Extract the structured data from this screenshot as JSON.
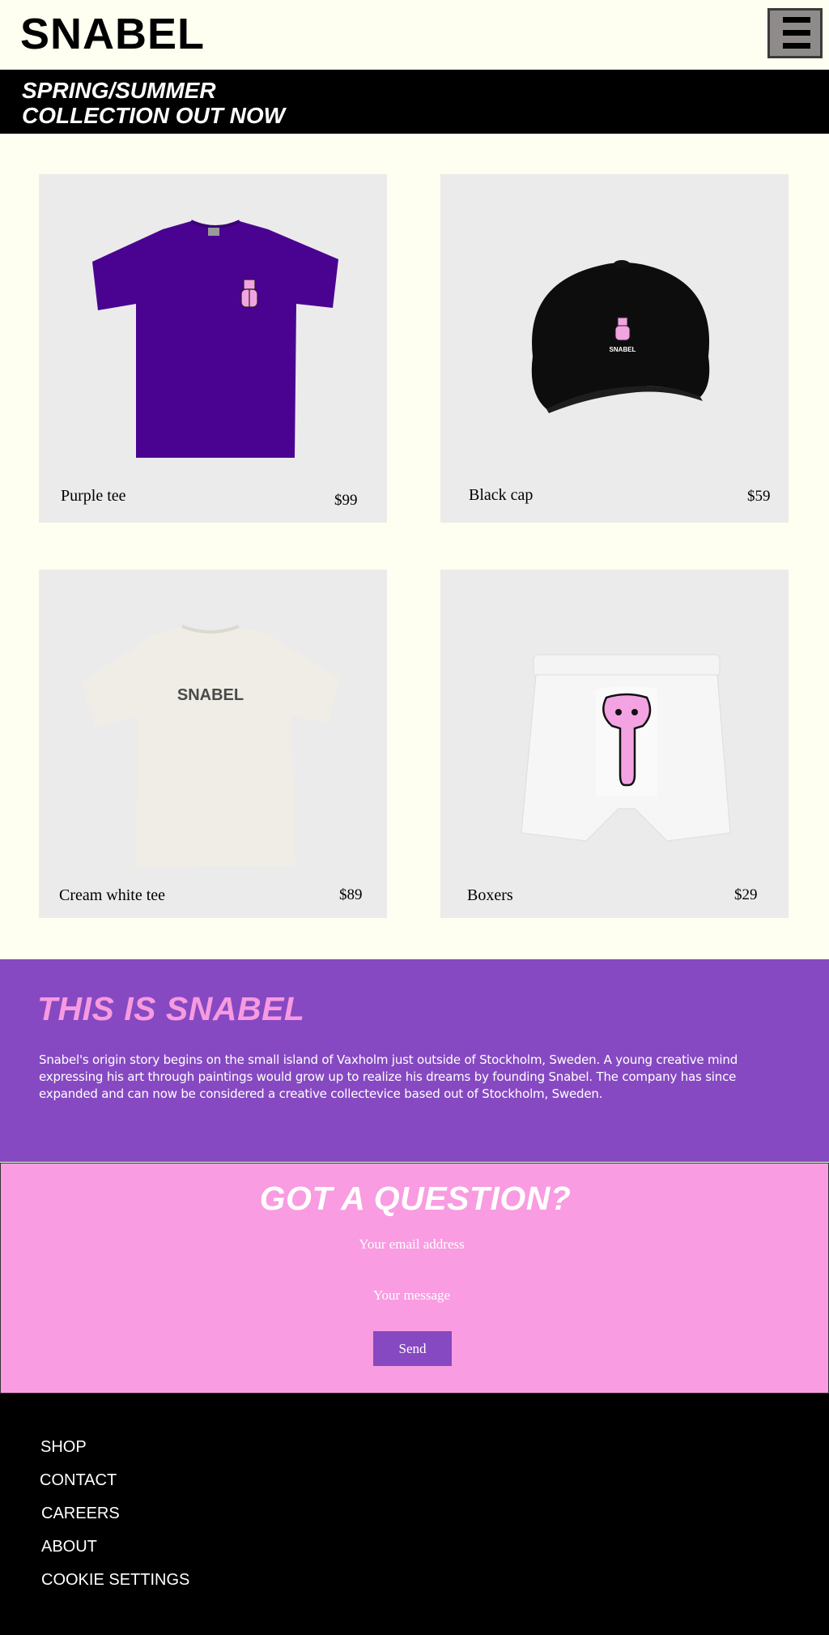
{
  "header": {
    "logo": "SNABEL",
    "menu_icon": "hamburger-menu-icon"
  },
  "banner": {
    "text": "SPRING/SUMMER\nCOLLECTION OUT NOW"
  },
  "products": [
    {
      "name": "Purple tee",
      "price": "$99"
    },
    {
      "name": "Black cap",
      "price": "$59"
    },
    {
      "name": "Cream white tee",
      "price": "$89"
    },
    {
      "name": "Boxers",
      "price": "$29"
    }
  ],
  "product_prints": {
    "cap": "SNABEL",
    "cream_tee": "SNABEL"
  },
  "about": {
    "title": "THIS IS SNABEL",
    "body": "Snabel's origin story begins on the small island of Vaxholm just outside of Stockholm, Sweden. A young creative mind expressing his art through paintings would grow up to realize his dreams by founding Snabel. The company has since expanded and can now be considered a creative collectevice based out of Stockholm, Sweden."
  },
  "contact": {
    "title": "GOT A QUESTION?",
    "email_placeholder": "Your email address",
    "message_placeholder": "Your message",
    "send_label": "Send"
  },
  "footer": {
    "links": [
      "SHOP",
      "CONTACT",
      "CAREERS",
      "ABOUT",
      "COOKIE SETTINGS"
    ]
  },
  "colors": {
    "background": "#fefff0",
    "purple": "#8649c2",
    "pink": "#f99ce1",
    "black": "#000000"
  }
}
